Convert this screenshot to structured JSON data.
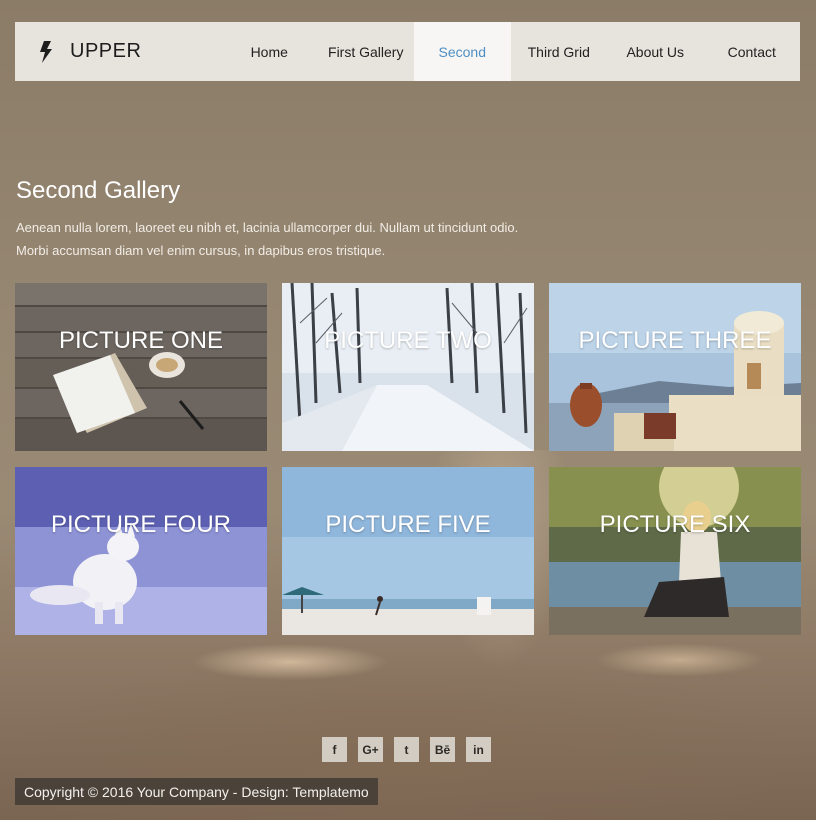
{
  "brand": {
    "name": "UPPER",
    "icon": "bolt-icon"
  },
  "nav": {
    "items": [
      {
        "label": "Home",
        "active": false
      },
      {
        "label": "First Gallery",
        "active": false
      },
      {
        "label": "Second",
        "active": true
      },
      {
        "label": "Third Grid",
        "active": false
      },
      {
        "label": "About Us",
        "active": false
      },
      {
        "label": "Contact",
        "active": false
      }
    ],
    "active_color": "#4f8fc4"
  },
  "intro": {
    "title": "Second Gallery",
    "lines": [
      "Aenean nulla lorem, laoreet eu nibh et, lacinia ullamcorper dui. Nullam ut tincidunt odio.",
      "Morbi accumsan diam vel enim cursus, in dapibus eros tristique."
    ]
  },
  "gallery": {
    "items": [
      {
        "caption": "PICTURE ONE"
      },
      {
        "caption": "PICTURE TWO"
      },
      {
        "caption": "PICTURE THREE"
      },
      {
        "caption": "PICTURE FOUR"
      },
      {
        "caption": "PICTURE FIVE"
      },
      {
        "caption": "PICTURE SIX"
      }
    ]
  },
  "social": {
    "items": [
      {
        "icon": "facebook-icon",
        "glyph": "f"
      },
      {
        "icon": "google-plus-icon",
        "glyph": "G+"
      },
      {
        "icon": "twitter-icon",
        "glyph": "t"
      },
      {
        "icon": "behance-icon",
        "glyph": "Bē"
      },
      {
        "icon": "linkedin-icon",
        "glyph": "in"
      }
    ]
  },
  "footer": {
    "copyright": "Copyright © 2016 Your Company - Design: Templatemo"
  }
}
